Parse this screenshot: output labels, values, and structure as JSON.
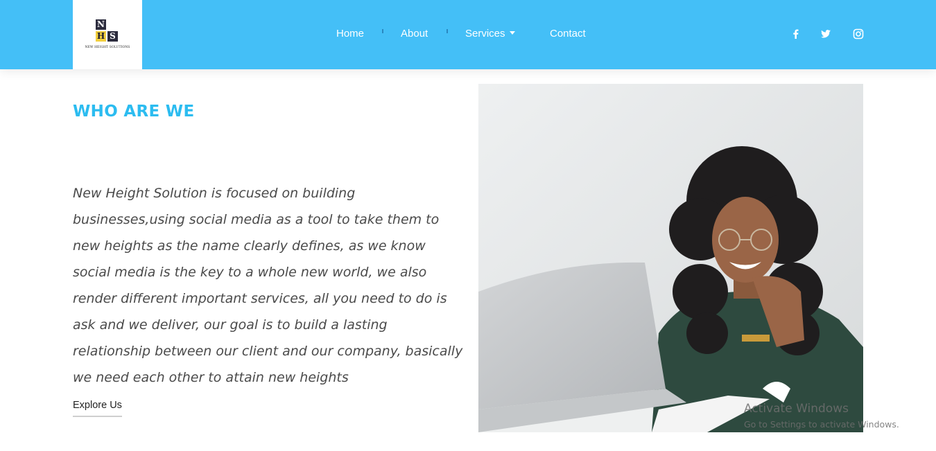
{
  "logo": {
    "letter_n": "N",
    "letter_h": "H",
    "letter_s": "S",
    "tagline": "NEW HEIGHT SOLUTIONS"
  },
  "nav": {
    "items": [
      {
        "label": "Home"
      },
      {
        "label": "About"
      },
      {
        "label": "Services",
        "has_dropdown": true
      },
      {
        "label": "Contact"
      }
    ]
  },
  "social": {
    "icons": [
      "facebook-icon",
      "twitter-icon",
      "instagram-icon"
    ]
  },
  "about": {
    "heading": "WHO ARE WE",
    "paragraph": "New Height Solution is focused on building businesses,using social media as a tool to take them to new heights as the name clearly defines, as we know social media is the key to a whole new world, we also render different important services, all you need to do is ask and we deliver, our goal is to build a lasting relationship between our client and our company, basically we need each other to attain new heights",
    "cta_label": "Explore Us"
  },
  "watermark": {
    "title": "Activate Windows",
    "subtitle": "Go to Settings to activate Windows."
  },
  "colors": {
    "navbar": "#44bff7",
    "heading": "#2cbcf0",
    "logo_accent": "#f3d03e"
  }
}
